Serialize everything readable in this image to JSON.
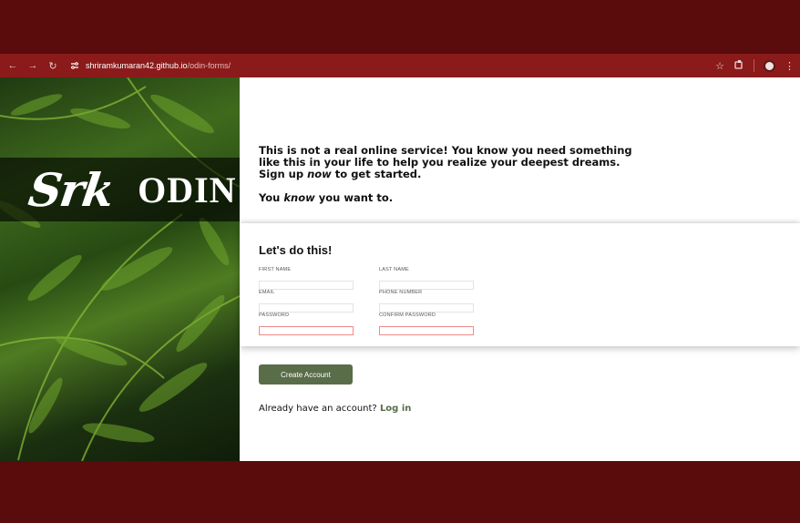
{
  "browser": {
    "url_host": "shriramkumaran42.github.io",
    "url_path": "/odin-forms/",
    "icons": [
      "back-icon",
      "forward-icon",
      "reload-icon",
      "site-settings-icon",
      "star-icon",
      "extensions-icon",
      "profile-icon",
      "menu-icon"
    ]
  },
  "hero": {
    "logo_mark": "Srk",
    "logo_text": "ODIN"
  },
  "intro": {
    "line1_a": "This is not a real online service! You know you need something like this in your life to help you realize your deepest dreams. Sign up ",
    "line1_em": "now",
    "line1_b": " to get started.",
    "line2_a": "You ",
    "line2_em": "know",
    "line2_b": " you want to."
  },
  "form": {
    "heading": "Let's do this!",
    "fields": [
      {
        "label": "FIRST NAME",
        "value": ""
      },
      {
        "label": "LAST NAME",
        "value": ""
      },
      {
        "label": "EMAIL",
        "value": ""
      },
      {
        "label": "PHONE NUMBER",
        "value": ""
      },
      {
        "label": "PASSWORD",
        "value": ""
      },
      {
        "label": "CONFIRM PASSWORD",
        "value": ""
      }
    ]
  },
  "actions": {
    "create_account_label": "Create Account",
    "login_prompt": "Already have an account?",
    "login_link": "Log in"
  },
  "colors": {
    "background": "#5a0b0b",
    "browser_bar": "#8b1a1a",
    "accent_button": "#596d48",
    "invalid_border": "#f08a8a"
  }
}
